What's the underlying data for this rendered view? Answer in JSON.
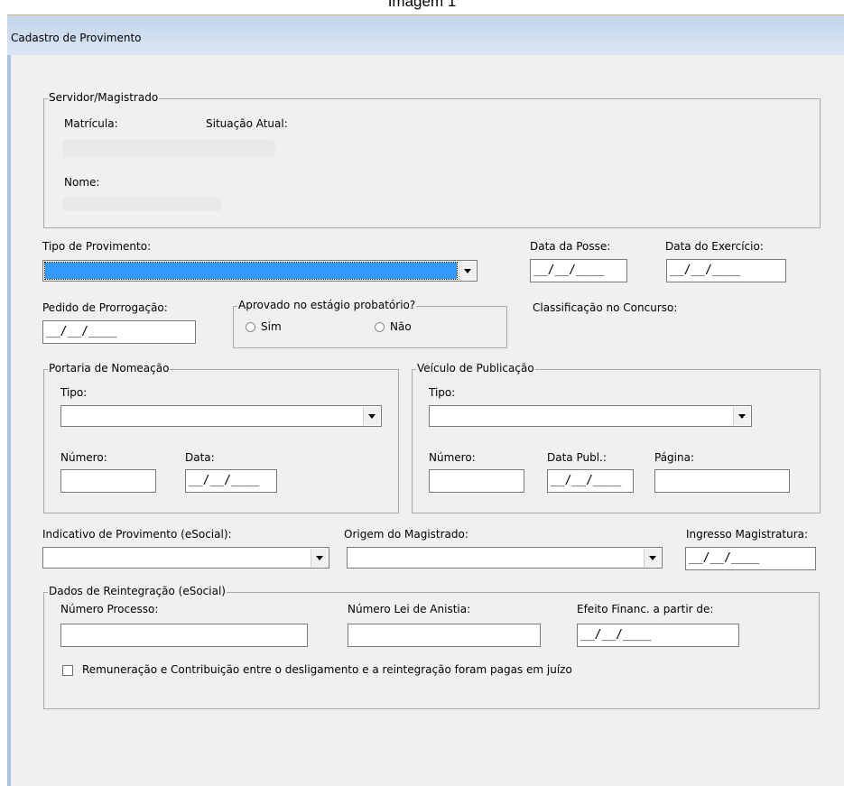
{
  "caption": "Imagem 1",
  "window": {
    "title": "Cadastro de Provimento"
  },
  "servidor": {
    "group_title": "Servidor/Magistrado",
    "matricula_label": "Matrícula:",
    "situacao_label": "Situação Atual:",
    "nome_label": "Nome:"
  },
  "tipo_provimento": {
    "label": "Tipo de Provimento:"
  },
  "data_posse": {
    "label": "Data da Posse:",
    "value": "__/__/____"
  },
  "data_exercicio": {
    "label": "Data do Exercício:",
    "value": "__/__/____"
  },
  "pedido_prorrogacao": {
    "label": "Pedido de Prorrogação:",
    "value": "__/__/____"
  },
  "estagio": {
    "group_title": "Aprovado no estágio probatório?",
    "sim": "Sim",
    "nao": "Não"
  },
  "classificacao": {
    "label": "Classificação no Concurso:"
  },
  "portaria": {
    "group_title": "Portaria de Nomeação",
    "tipo_label": "Tipo:",
    "numero_label": "Número:",
    "data_label": "Data:",
    "data_value": "__/__/____"
  },
  "veiculo": {
    "group_title": "Veículo de Publicação",
    "tipo_label": "Tipo:",
    "numero_label": "Número:",
    "data_publ_label": "Data Publ.:",
    "data_publ_value": "__/__/____",
    "pagina_label": "Página:"
  },
  "indicativo": {
    "label": "Indicativo de Provimento (eSocial):"
  },
  "origem": {
    "label": "Origem do Magistrado:"
  },
  "ingresso": {
    "label": "Ingresso Magistratura:",
    "value": "__/__/____"
  },
  "reintegracao": {
    "group_title": "Dados de Reintegração (eSocial)",
    "numero_processo_label": "Número Processo:",
    "numero_lei_label": "Número Lei de Anistia:",
    "efeito_label": "Efeito Financ. a partir de:",
    "efeito_value": "__/__/____",
    "checkbox_label": "Remuneração e Contribuição entre o desligamento e a reintegração foram pagas em juízo"
  }
}
